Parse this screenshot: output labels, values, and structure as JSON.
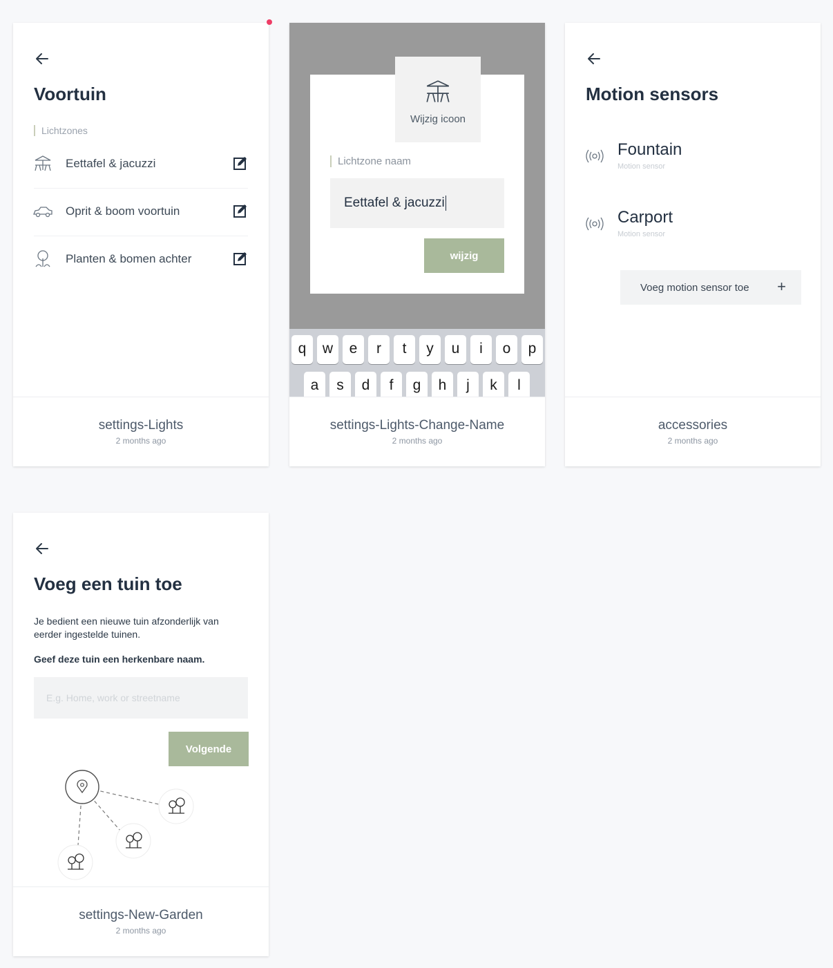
{
  "colors": {
    "accent_green": "#a9b99b",
    "notification_dot": "#ee3d66",
    "overlay": "#9a9a9a"
  },
  "cards": {
    "lights": {
      "title": "Voortuin",
      "section_label": "Lichtzones",
      "zones": [
        {
          "label": "Eettafel & jacuzzi",
          "icon": "table-umbrella-icon"
        },
        {
          "label": "Oprit & boom voortuin",
          "icon": "car-icon"
        },
        {
          "label": "Planten & bomen achter",
          "icon": "tree-icon"
        }
      ],
      "footer": {
        "title": "settings-Lights",
        "time": "2 months ago"
      }
    },
    "change_name": {
      "icon_tile_label": "Wijzig icoon",
      "field_label": "Lichtzone naam",
      "field_value": "Eettafel & jacuzzi",
      "button": "wijzig",
      "keyboard_row1": [
        "q",
        "w",
        "e",
        "r",
        "t",
        "y",
        "u",
        "i",
        "o",
        "p"
      ],
      "keyboard_row2": [
        "a",
        "s",
        "d",
        "f",
        "g",
        "h",
        "j",
        "k",
        "l"
      ],
      "footer": {
        "title": "settings-Lights-Change-Name",
        "time": "2 months ago"
      }
    },
    "accessories": {
      "title": "Motion sensors",
      "sensors": [
        {
          "name": "Fountain",
          "sub": "Motion sensor"
        },
        {
          "name": "Carport",
          "sub": "Motion sensor"
        }
      ],
      "add_button": "Voeg motion sensor toe",
      "add_symbol": "+",
      "footer": {
        "title": "accessories",
        "time": "2 months ago"
      }
    },
    "new_garden": {
      "title": "Voeg een tuin toe",
      "paragraph": "Je bedient een nieuwe tuin afzonderlijk van eerder ingestelde tuinen.",
      "instruction": "Geef deze tuin een herkenbare naam.",
      "input_placeholder": "E.g. Home, work or streetname",
      "button": "Volgende",
      "footer": {
        "title": "settings-New-Garden",
        "time": "2 months ago"
      }
    }
  }
}
